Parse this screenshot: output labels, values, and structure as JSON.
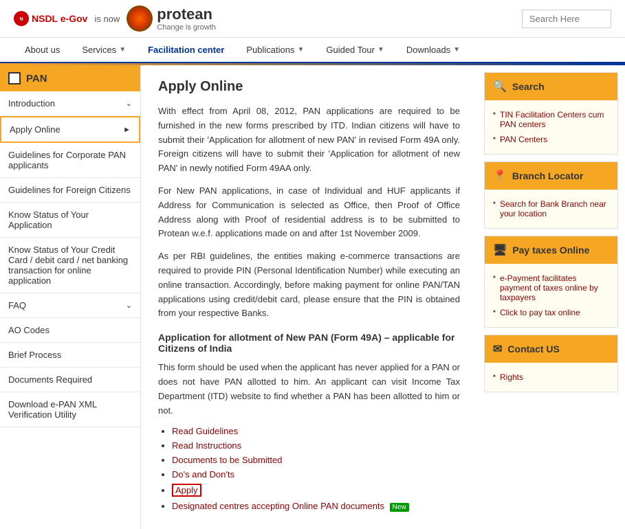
{
  "header": {
    "nsdl_text": "NSDL e-Gov",
    "is_now": "is now",
    "protean_name": "protean",
    "protean_tagline": "Change is growth",
    "search_placeholder": "Search Here"
  },
  "nav": {
    "items": [
      {
        "label": "About us",
        "has_arrow": false
      },
      {
        "label": "Services",
        "has_arrow": true
      },
      {
        "label": "Facilitation center",
        "has_arrow": false,
        "active": true
      },
      {
        "label": "Publications",
        "has_arrow": true
      },
      {
        "label": "Guided Tour",
        "has_arrow": true
      },
      {
        "label": "Downloads",
        "has_arrow": true
      }
    ]
  },
  "sidebar": {
    "header": "PAN",
    "items": [
      {
        "label": "Introduction",
        "has_arrow": true
      },
      {
        "label": "Apply Online",
        "has_arrow": true,
        "active": true
      },
      {
        "label": "Guidelines for Corporate PAN applicants",
        "has_arrow": false
      },
      {
        "label": "Guidelines for Foreign Citizens",
        "has_arrow": false
      },
      {
        "label": "Know Status of Your Application",
        "has_arrow": false
      },
      {
        "label": "Know Status of Your Credit Card / debit card / net banking transaction for online application",
        "has_arrow": false
      },
      {
        "label": "FAQ",
        "has_arrow": true
      },
      {
        "label": "AO Codes",
        "has_arrow": false
      },
      {
        "label": "Brief Process",
        "has_arrow": false
      },
      {
        "label": "Documents Required",
        "has_arrow": false
      },
      {
        "label": "Download e-PAN XML Verification Utility",
        "has_arrow": false
      }
    ]
  },
  "content": {
    "title": "Apply Online",
    "paragraphs": [
      "With effect from April 08, 2012, PAN applications are required to be furnished in the new forms prescribed by ITD. Indian citizens will have to submit their 'Application for allotment of new PAN' in revised Form 49A only. Foreign citizens will have to submit their 'Application for allotment of new PAN' in newly notified Form 49AA only.",
      "For New PAN applications, in case of Individual and HUF applicants if Address for Communication is selected as Office, then Proof of Office Address along with Proof of residential address is to be submitted to Protean w.e.f. applications made on and after 1st November 2009.",
      "As per RBI guidelines, the entities making e-commerce transactions are required to provide PIN (Personal Identification Number) while executing an online transaction. Accordingly, before making payment for online PAN/TAN applications using credit/debit card, please ensure that the PIN is obtained from your respective Banks."
    ],
    "section_title": "Application for allotment of New PAN (Form 49A) – applicable for Citizens of India",
    "section_intro": "This form should be used when the applicant has never applied for a PAN or does not have PAN allotted to him. An applicant can visit Income Tax Department (ITD) website to find whether a PAN has been allotted to him or not.",
    "links": [
      {
        "label": "Read Guidelines",
        "highlighted": false
      },
      {
        "label": "Read Instructions",
        "highlighted": false
      },
      {
        "label": "Documents to be Submitted",
        "highlighted": false
      },
      {
        "label": "Do's and Don'ts",
        "highlighted": false
      },
      {
        "label": "Apply",
        "highlighted": true
      },
      {
        "label": "Designated centres accepting Online PAN documents",
        "highlighted": false,
        "badge": "New"
      }
    ]
  },
  "right_widgets": [
    {
      "id": "search",
      "icon": "🔍",
      "title": "Search",
      "items": [
        {
          "label": "TIN Facilitation Centers cum PAN centers"
        },
        {
          "label": "PAN Centers"
        }
      ]
    },
    {
      "id": "branch",
      "icon": "📍",
      "title": "Branch Locator",
      "items": [
        {
          "label": "Search for Bank Branch near your location"
        }
      ]
    },
    {
      "id": "taxes",
      "icon": "🖥",
      "title": "Pay taxes Online",
      "items": [
        {
          "label": "e-Payment facilitates payment of taxes online by taxpayers"
        },
        {
          "label": "Click to pay tax online"
        }
      ]
    },
    {
      "id": "contact",
      "icon": "✉",
      "title": "Contact US",
      "items": [
        {
          "label": "Rights"
        }
      ]
    }
  ]
}
